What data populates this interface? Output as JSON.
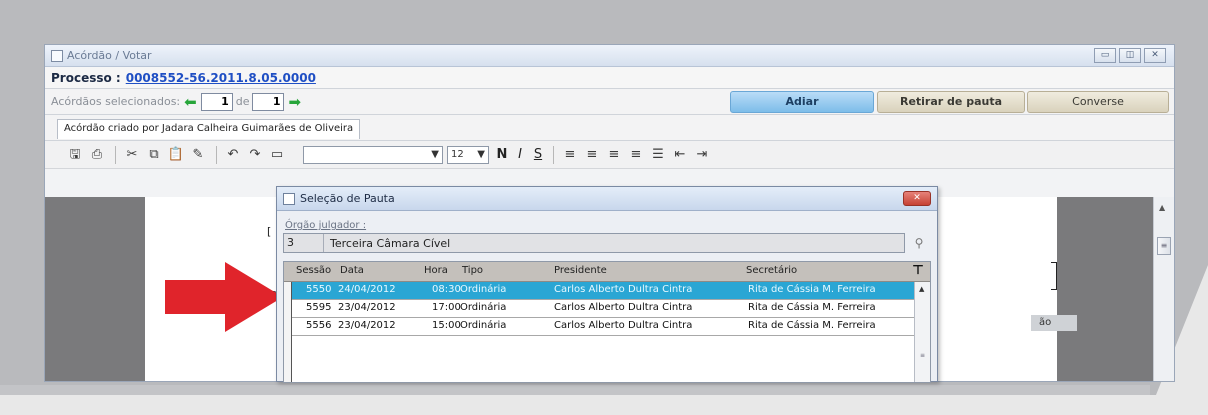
{
  "window": {
    "title": "Acórdão / Votar",
    "controls": [
      "▭",
      "◫",
      "✕"
    ]
  },
  "process": {
    "label": "Processo :",
    "number": "0008552-56.2011.8.05.0000"
  },
  "selection": {
    "label": "Acórdãos selecionados:",
    "current": "1",
    "de": "de",
    "total": "1"
  },
  "actions": {
    "adiar": "Adiar",
    "retirar": "Retirar de pauta",
    "converter": "Converse"
  },
  "tab": {
    "label": "Acórdão criado por Jadara Calheira Guimarães de Oliveira"
  },
  "toolbar": {
    "font_size": "12",
    "bold": "N",
    "italic": "I",
    "strike": "S"
  },
  "editor": {
    "side_fragment": "ão"
  },
  "dialog": {
    "title": "Seleção de Pauta",
    "orgao_label": "Órgão julgador :",
    "orgao_code": "3",
    "orgao_name": "Terceira Câmara Cível",
    "columns": [
      "Sessão",
      "Data",
      "Hora",
      "Tipo",
      "Presidente",
      "Secretário"
    ],
    "rows": [
      {
        "sessao": "5550",
        "data": "24/04/2012",
        "hora": "08:30",
        "tipo": "Ordinária",
        "presidente": "Carlos Alberto Dultra Cintra",
        "secretario": "Rita de Cássia M. Ferreira"
      },
      {
        "sessao": "5595",
        "data": "23/04/2012",
        "hora": "17:00",
        "tipo": "Ordinária",
        "presidente": "Carlos Alberto Dultra Cintra",
        "secretario": "Rita de Cássia M. Ferreira"
      },
      {
        "sessao": "5556",
        "data": "23/04/2012",
        "hora": "15:00",
        "tipo": "Ordinária",
        "presidente": "Carlos Alberto Dultra Cintra",
        "secretario": "Rita de Cássia M. Ferreira"
      }
    ]
  },
  "colors": {
    "selected_row": "#2aa6d4",
    "adiar_button": "#7dbde9",
    "red_arrow": "#e0242b"
  }
}
